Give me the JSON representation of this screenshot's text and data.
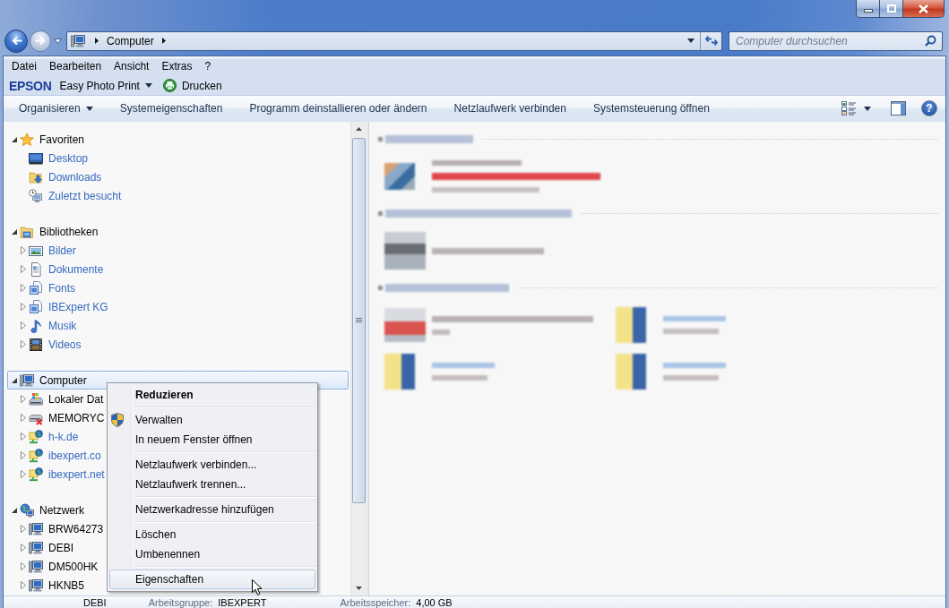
{
  "window": {
    "caption_buttons": [
      {
        "kind": "minimize"
      },
      {
        "kind": "maximize"
      },
      {
        "kind": "close"
      }
    ]
  },
  "navigation": {
    "back": {
      "disabled": false
    },
    "forward": {
      "disabled": true
    },
    "address": {
      "segments": [
        "Computer"
      ]
    },
    "search": {
      "placeholder": "Computer durchsuchen"
    }
  },
  "menu_bar": [
    "Datei",
    "Bearbeiten",
    "Ansicht",
    "Extras",
    "?"
  ],
  "epson_bar": {
    "logo": "EPSON",
    "app": "Easy Photo Print",
    "print": "Drucken"
  },
  "command_bar": {
    "buttons": [
      {
        "label": "Organisieren",
        "dropdown": true
      },
      {
        "label": "Systemeigenschaften",
        "dropdown": false
      },
      {
        "label": "Programm deinstallieren oder ändern",
        "dropdown": false
      },
      {
        "label": "Netzlaufwerk verbinden",
        "dropdown": false
      },
      {
        "label": "Systemsteuerung öffnen",
        "dropdown": false
      }
    ],
    "help": "?"
  },
  "nav_tree": [
    {
      "label": "Favoriten",
      "kind": "favorites",
      "expanded": true,
      "selected": false,
      "color": "#000000",
      "children": [
        {
          "label": "Desktop",
          "kind": "desktop",
          "selected": false,
          "color": "#3568bf"
        },
        {
          "label": "Downloads",
          "kind": "downloads",
          "selected": false,
          "color": "#3568bf"
        },
        {
          "label": "Zuletzt besucht",
          "kind": "recent",
          "selected": false,
          "color": "#3568bf"
        }
      ]
    },
    {
      "label": "Bibliotheken",
      "kind": "libraries",
      "expanded": true,
      "selected": false,
      "color": "#000000",
      "children": [
        {
          "label": "Bilder",
          "kind": "pictures",
          "expanded": false,
          "selected": false,
          "color": "#3568bf"
        },
        {
          "label": "Dokumente",
          "kind": "documents",
          "expanded": false,
          "selected": false,
          "color": "#3568bf"
        },
        {
          "label": "Fonts",
          "kind": "library",
          "expanded": false,
          "selected": false,
          "color": "#3568bf"
        },
        {
          "label": "IBExpert KG",
          "kind": "library",
          "expanded": false,
          "selected": false,
          "color": "#3568bf"
        },
        {
          "label": "Musik",
          "kind": "music",
          "expanded": false,
          "selected": false,
          "color": "#3568bf"
        },
        {
          "label": "Videos",
          "kind": "videos",
          "expanded": false,
          "selected": false,
          "color": "#3568bf"
        }
      ]
    },
    {
      "label": "Computer",
      "kind": "computer",
      "expanded": true,
      "selected": true,
      "color": "#000000",
      "children": [
        {
          "label": "Lokaler Dat",
          "kind": "drive",
          "expanded": false,
          "selected": false,
          "color": "#000000"
        },
        {
          "label": "MEMORYC",
          "kind": "removable",
          "expanded": false,
          "selected": false,
          "color": "#000000"
        },
        {
          "label": "h-k.de",
          "kind": "network-drive",
          "expanded": false,
          "selected": false,
          "color": "#3568bf"
        },
        {
          "label": "ibexpert.co",
          "kind": "network-drive",
          "expanded": false,
          "selected": false,
          "color": "#3568bf"
        },
        {
          "label": "ibexpert.net",
          "kind": "network-drive",
          "expanded": false,
          "selected": false,
          "color": "#3568bf"
        }
      ]
    },
    {
      "label": "Netzwerk",
      "kind": "network",
      "expanded": true,
      "selected": false,
      "color": "#000000",
      "children": [
        {
          "label": "BRW64273",
          "kind": "pc",
          "expanded": false,
          "selected": false,
          "color": "#000000"
        },
        {
          "label": "DEBI",
          "kind": "pc",
          "expanded": false,
          "selected": false,
          "color": "#000000"
        },
        {
          "label": "DM500HK",
          "kind": "pc",
          "expanded": false,
          "selected": false,
          "color": "#000000"
        },
        {
          "label": "HKNB5",
          "kind": "pc",
          "expanded": false,
          "selected": false,
          "color": "#000000"
        }
      ]
    }
  ],
  "context_menu": {
    "sections": [
      {
        "items": [
          {
            "label": "Reduzieren",
            "kind": "plain",
            "default": true,
            "selected": false
          }
        ]
      },
      {
        "items": [
          {
            "label": "Verwalten",
            "kind": "shield",
            "default": false,
            "selected": false
          },
          {
            "label": "In neuem Fenster öffnen",
            "kind": "plain",
            "default": false,
            "selected": false
          }
        ]
      },
      {
        "items": [
          {
            "label": "Netzlaufwerk verbinden...",
            "kind": "plain",
            "default": false,
            "selected": false
          },
          {
            "label": "Netzlaufwerk trennen...",
            "kind": "plain",
            "default": false,
            "selected": false
          }
        ]
      },
      {
        "items": [
          {
            "label": "Netzwerkadresse hinzufügen",
            "kind": "plain",
            "default": false,
            "selected": false
          }
        ]
      },
      {
        "items": [
          {
            "label": "Löschen",
            "kind": "plain",
            "default": false,
            "selected": false
          },
          {
            "label": "Umbenennen",
            "kind": "plain",
            "default": false,
            "selected": false
          }
        ]
      },
      {
        "items": [
          {
            "label": "Eigenschaften",
            "kind": "plain",
            "default": false,
            "selected": true
          }
        ]
      }
    ]
  },
  "content_pane": {
    "groups": [
      {
        "kind": "drives",
        "items": [
          {
            "kind": "drive"
          }
        ]
      },
      {
        "kind": "removable",
        "items": [
          {
            "kind": "removable"
          }
        ]
      },
      {
        "kind": "network",
        "items": [
          {
            "kind": "network-error"
          },
          {
            "kind": "network"
          },
          {
            "kind": "network"
          },
          {
            "kind": "network"
          }
        ]
      }
    ]
  },
  "details_pane": {
    "name": "DEBI",
    "fields": [
      {
        "label": "Arbeitsgruppe:",
        "value": "IBEXPERT"
      },
      {
        "label": "Arbeitsspeicher:",
        "value": "4,00 GB"
      }
    ]
  }
}
